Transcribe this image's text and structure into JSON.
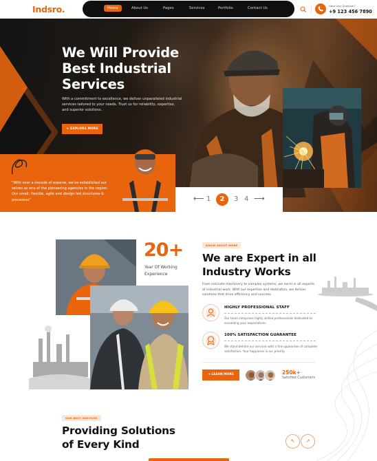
{
  "colors": {
    "accent": "#e8650e",
    "dark": "#0f0f10",
    "tag_bg": "#fde6d6"
  },
  "header": {
    "logo": "Indsro",
    "logo_dot": ".",
    "nav": [
      "Home",
      "About Us",
      "Pages",
      "Services",
      "Portfolio",
      "Contact Us"
    ],
    "active_nav": "Home",
    "help_label": "Have Any Question?",
    "phone": "+9 123 456 7890",
    "icons": {
      "search": "search-icon",
      "phone": "phone-icon"
    }
  },
  "hero": {
    "title": "We Will Provide Best Industrial Services",
    "description": "With a commitment to excellence, we deliver unparalleled industrial services tailored to your needs. Trust us for reliability, expertise, and superior solutions.",
    "cta_label": "EXPLORE MORE",
    "cta_icon": "arrow-right-icon",
    "quote": "\"With over a decade of experie, we've established our selves as one of the pioneering agencies in the region. Our small, flexible, agile and design-led structures & processes\"",
    "pagination": {
      "prev_icon": "arrow-left-icon",
      "next_icon": "arrow-right-icon",
      "pages": [
        "1",
        "2",
        "3",
        "4"
      ],
      "current": "2"
    }
  },
  "about": {
    "stat_number": "20+",
    "stat_caption": "Year Of  Working Experience",
    "tag": "KNOW ABOUT MORE",
    "title": "We are Expert in all Industry Works",
    "description": "From intricate machinery to complex systems, we excel in all aspects of industrial work. With our expertise and dedication, we deliver solutions that drive efficiency and success.",
    "features": [
      {
        "title": "HIGHLY PROFESSIONAL STAFF",
        "description": "Our team comprises highly skilled professionals dedicated to exceeding your expectations.",
        "icon": "staff-icon"
      },
      {
        "title": "100% SATISFACTION GUARANTEE",
        "description": "We stand behind our services with a firm guarantee of complete satisfaction. Your happiness is our priority.",
        "icon": "guarantee-icon"
      }
    ],
    "cta_label": "LEARN MORE",
    "customers_count": "250k+",
    "customers_label": "Satisfied Customers"
  },
  "services": {
    "tag": "OUR BEST SERVICES",
    "title": "Providing Solutions of Every Kind",
    "prev_icon": "arrow-up-left-icon",
    "next_icon": "arrow-up-right-icon"
  }
}
